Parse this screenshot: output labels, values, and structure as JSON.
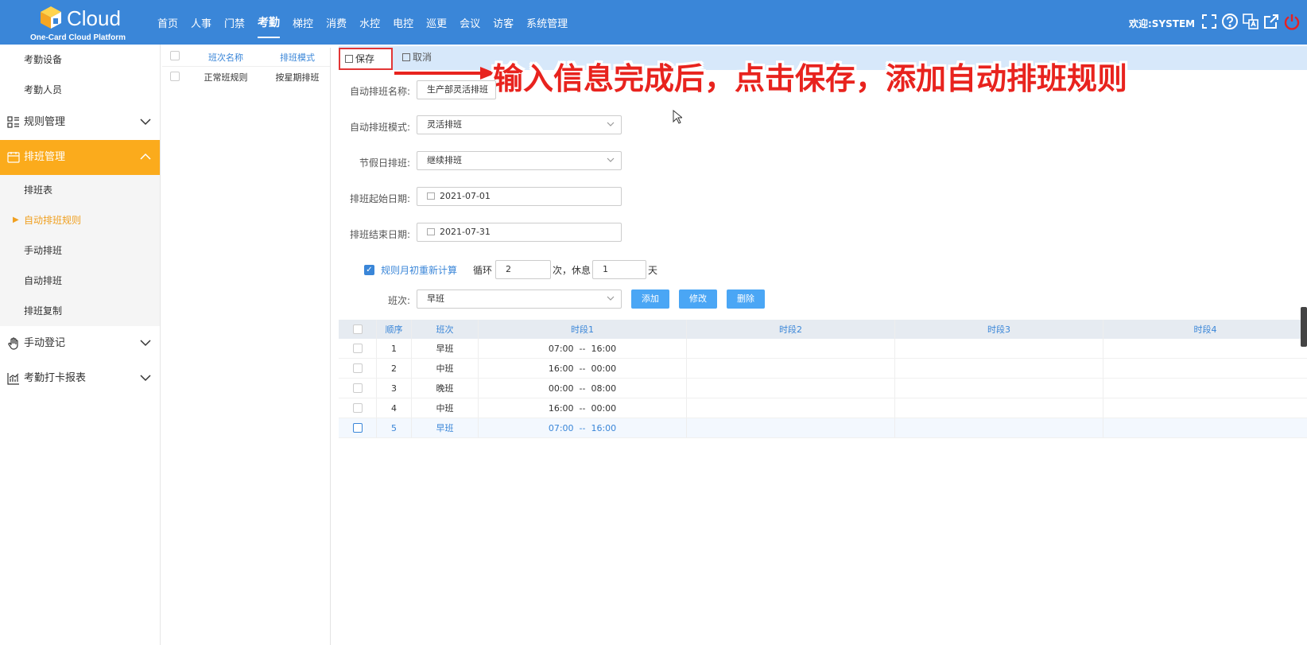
{
  "header": {
    "logo_text": "Cloud",
    "logo_sub": "One-Card Cloud Platform",
    "nav": [
      "首页",
      "人事",
      "门禁",
      "考勤",
      "梯控",
      "消费",
      "水控",
      "电控",
      "巡更",
      "会议",
      "访客",
      "系统管理"
    ],
    "active_nav": "考勤",
    "welcome": "欢迎:SYSTEM",
    "icons": [
      "fullscreen-icon",
      "help-icon",
      "language-icon",
      "external-link-icon",
      "power-icon"
    ]
  },
  "sidebar": {
    "top_items": [
      "考勤设备",
      "考勤人员"
    ],
    "group_rules": "规则管理",
    "group_schedule": "排班管理",
    "schedule_items": [
      "排班表",
      "自动排班规则",
      "手动排班",
      "自动排班",
      "排班复制"
    ],
    "group_manual": "手动登记",
    "group_report": "考勤打卡报表"
  },
  "rules_list": {
    "col_name": "班次名称",
    "col_mode": "排班模式",
    "rows": [
      {
        "name": "正常班规则",
        "mode": "按星期排班"
      }
    ]
  },
  "toolbar": {
    "save": "保存",
    "cancel": "取消"
  },
  "annotation": "输入信息完成后，点击保存，添加自动排班规则",
  "form": {
    "name_label": "自动排班名称:",
    "name_value": "生产部灵活排班",
    "mode_label": "自动排班模式:",
    "mode_value": "灵活排班",
    "holiday_label": "节假日排班:",
    "holiday_value": "继续排班",
    "start_label": "排班起始日期:",
    "start_value": "2021-07-01",
    "end_label": "排班结束日期:",
    "end_value": "2021-07-31",
    "recalc_label": "规则月初重新计算",
    "cycle_label": "循环",
    "cycle_value": "2",
    "times_rest_label": "次，休息",
    "rest_value": "1",
    "day_label": "天",
    "shift_label": "班次:",
    "shift_value": "早班",
    "add": "添加",
    "edit": "修改",
    "delete": "删除"
  },
  "grid": {
    "headers": [
      "顺序",
      "班次",
      "时段1",
      "时段2",
      "时段3",
      "时段4"
    ],
    "rows": [
      {
        "seq": "1",
        "shift": "早班",
        "p1": "07:00  --  16:00"
      },
      {
        "seq": "2",
        "shift": "中班",
        "p1": "16:00  --  00:00"
      },
      {
        "seq": "3",
        "shift": "晚班",
        "p1": "00:00  --  08:00"
      },
      {
        "seq": "4",
        "shift": "中班",
        "p1": "16:00  --  00:00"
      },
      {
        "seq": "5",
        "shift": "早班",
        "p1": "07:00  --  16:00"
      }
    ]
  },
  "colors": {
    "header_blue": "#3a86d8",
    "accent_orange": "#fbab1c",
    "button_blue": "#4aa6f5",
    "annotation_red": "#e8231e"
  }
}
